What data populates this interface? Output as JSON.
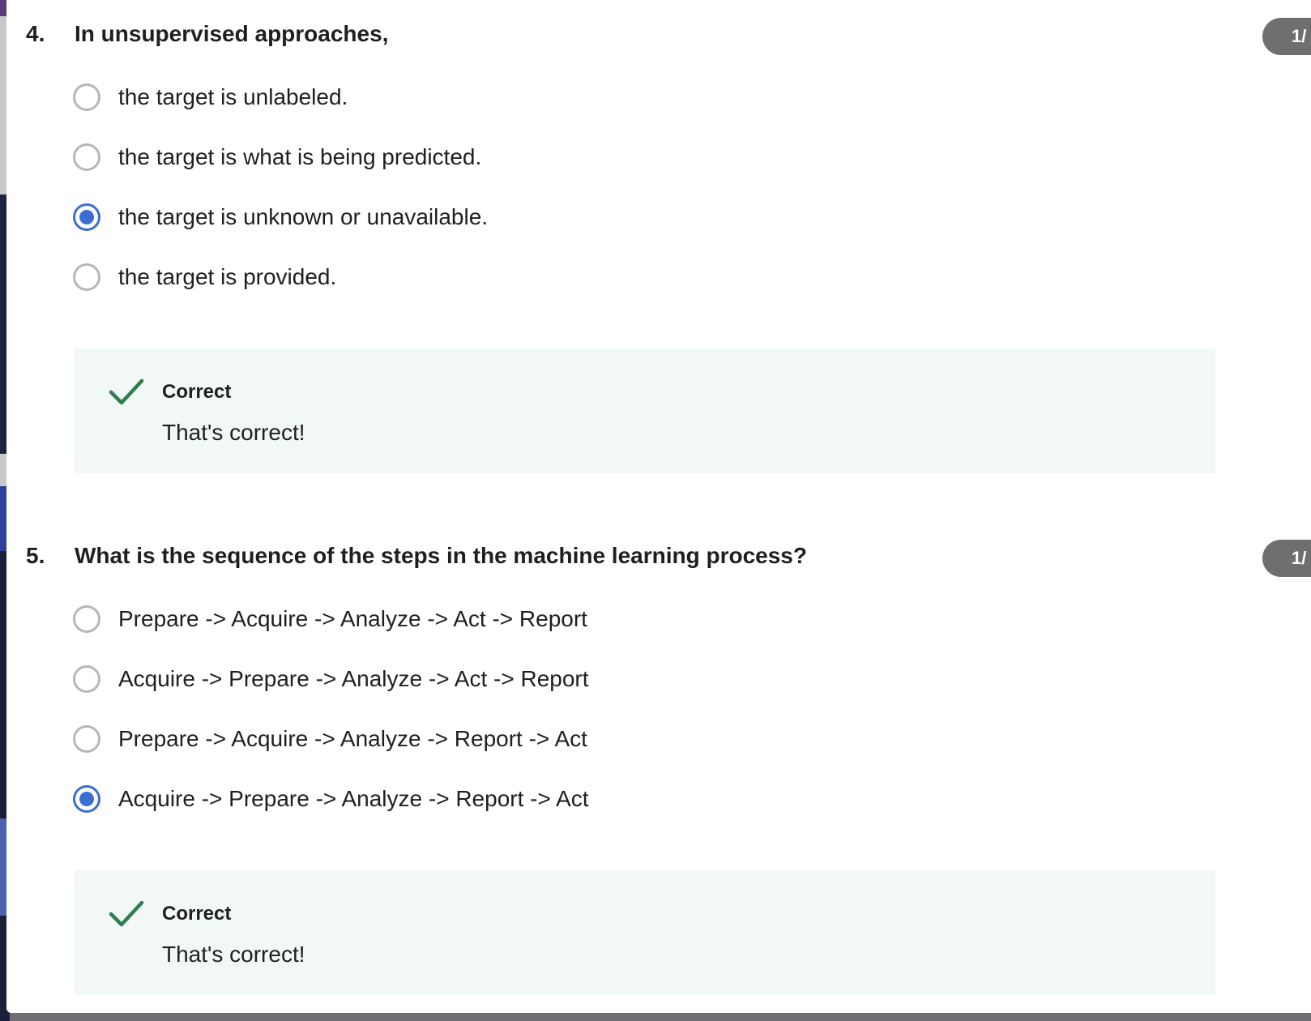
{
  "questions": [
    {
      "number": "4.",
      "title": "In unsupervised approaches,",
      "score": "1/",
      "selected_index": 2,
      "options": [
        "the target is unlabeled.",
        "the target is what is being predicted.",
        "the target is unknown or unavailable.",
        "the target is provided."
      ],
      "feedback": {
        "status": "Correct",
        "message": "That's correct!"
      }
    },
    {
      "number": "5.",
      "title": "What is the sequence of the steps in the machine learning process?",
      "score": "1/",
      "selected_index": 3,
      "options": [
        "Prepare -> Acquire -> Analyze -> Act -> Report",
        "Acquire -> Prepare -> Analyze -> Act -> Report",
        "Prepare -> Acquire -> Analyze -> Report -> Act",
        "Acquire -> Prepare -> Analyze -> Report -> Act"
      ],
      "feedback": {
        "status": "Correct",
        "message": "That's correct!"
      }
    }
  ],
  "colors": {
    "selected": "#3a6fd1",
    "unselected": "#b7b7b7",
    "correct_check": "#2e7d4f",
    "feedback_bg": "#f2f8f6",
    "score_pill": "#6f6f6f"
  },
  "icons": {
    "correct": "checkmark-icon"
  }
}
